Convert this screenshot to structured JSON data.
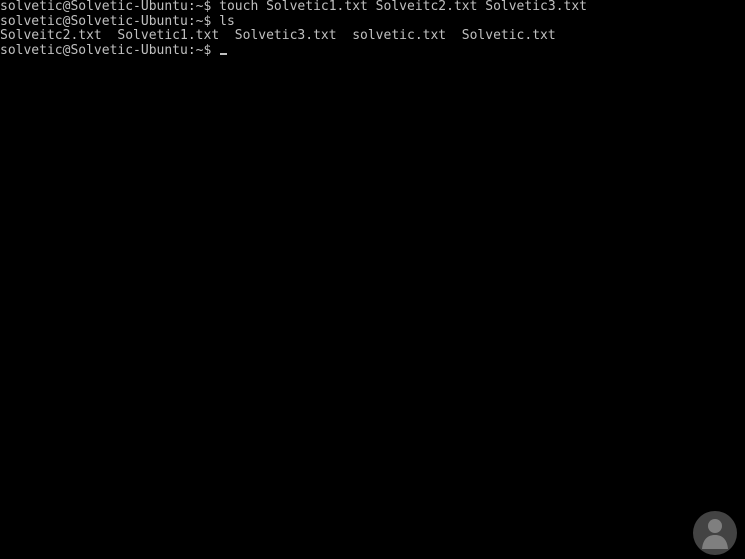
{
  "console": {
    "lines": [
      "solvetic@Solvetic-Ubuntu:~$ touch Solvetic1.txt Solveitc2.txt Solvetic3.txt",
      "solvetic@Solvetic-Ubuntu:~$ ls",
      "Solveitc2.txt  Solvetic1.txt  Solvetic3.txt  solvetic.txt  Solvetic.txt",
      "solvetic@Solvetic-Ubuntu:~$ "
    ]
  },
  "colors": {
    "background": "#000000",
    "text": "#c0c0c0"
  },
  "watermark": {
    "icon": "person-silhouette-logo-icon"
  }
}
